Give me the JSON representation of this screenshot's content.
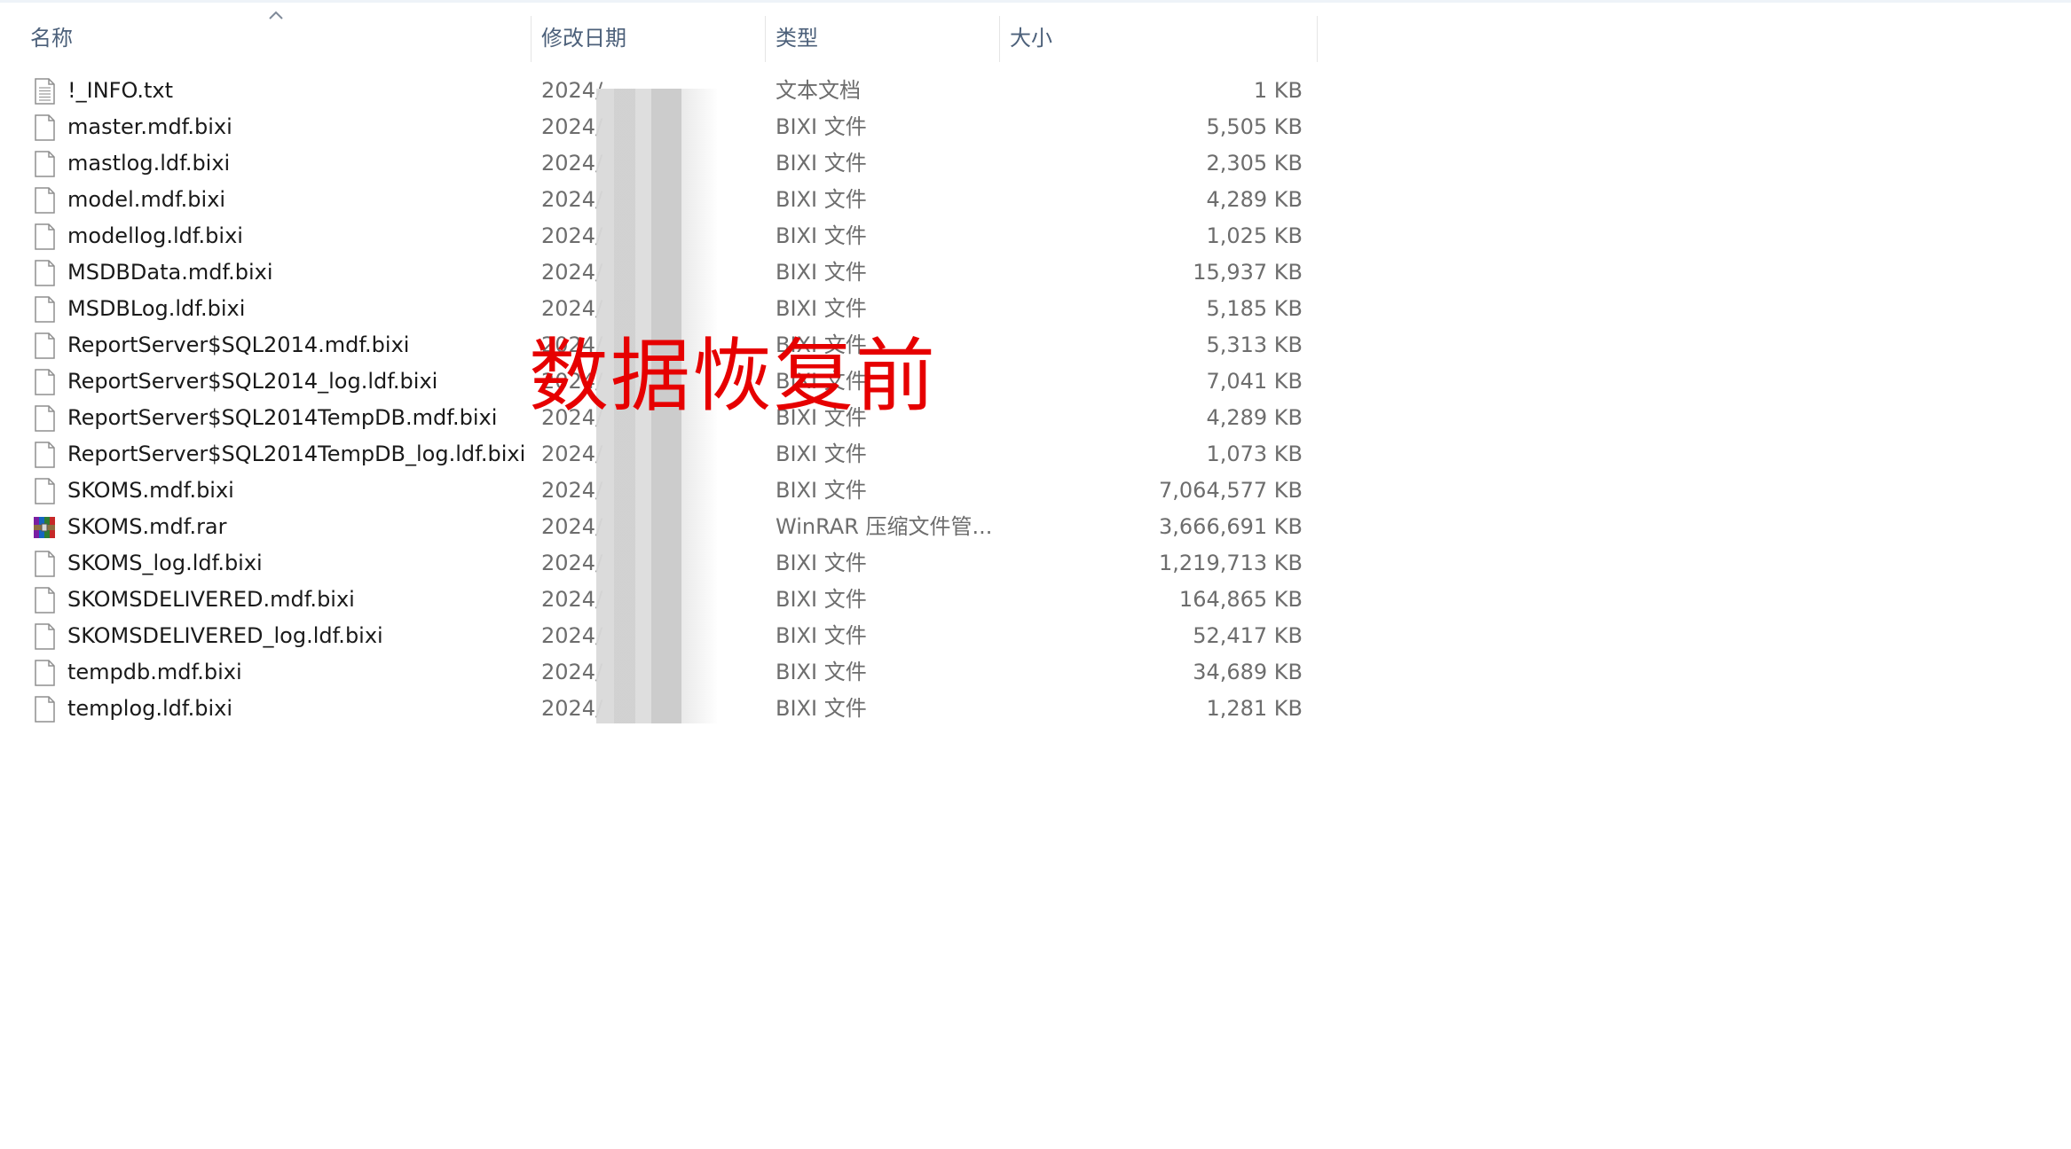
{
  "columns": {
    "name": "名称",
    "date": "修改日期",
    "type": "类型",
    "size": "大小"
  },
  "files": [
    {
      "name": "!_INFO.txt",
      "date": "2024/",
      "type": "文本文档",
      "size": "1 KB",
      "icon": "text-file-icon"
    },
    {
      "name": "master.mdf.bixi",
      "date": "2024/",
      "type": "BIXI 文件",
      "size": "5,505 KB",
      "icon": "blank-file-icon"
    },
    {
      "name": "mastlog.ldf.bixi",
      "date": "2024/",
      "type": "BIXI 文件",
      "size": "2,305 KB",
      "icon": "blank-file-icon"
    },
    {
      "name": "model.mdf.bixi",
      "date": "2024/",
      "type": "BIXI 文件",
      "size": "4,289 KB",
      "icon": "blank-file-icon"
    },
    {
      "name": "modellog.ldf.bixi",
      "date": "2024/",
      "type": "BIXI 文件",
      "size": "1,025 KB",
      "icon": "blank-file-icon"
    },
    {
      "name": "MSDBData.mdf.bixi",
      "date": "2024/",
      "type": "BIXI 文件",
      "size": "15,937 KB",
      "icon": "blank-file-icon"
    },
    {
      "name": "MSDBLog.ldf.bixi",
      "date": "2024/",
      "type": "BIXI 文件",
      "size": "5,185 KB",
      "icon": "blank-file-icon"
    },
    {
      "name": "ReportServer$SQL2014.mdf.bixi",
      "date": "2024/",
      "type": "BIXI 文件",
      "size": "5,313 KB",
      "icon": "blank-file-icon"
    },
    {
      "name": "ReportServer$SQL2014_log.ldf.bixi",
      "date": "2024/",
      "type": "BIXI 文件",
      "size": "7,041 KB",
      "icon": "blank-file-icon"
    },
    {
      "name": "ReportServer$SQL2014TempDB.mdf.bixi",
      "date": "2024/",
      "type": "BIXI 文件",
      "size": "4,289 KB",
      "icon": "blank-file-icon"
    },
    {
      "name": "ReportServer$SQL2014TempDB_log.ldf.bixi",
      "date": "2024/",
      "type": "BIXI 文件",
      "size": "1,073 KB",
      "icon": "blank-file-icon"
    },
    {
      "name": "SKOMS.mdf.bixi",
      "date": "2024/",
      "type": "BIXI 文件",
      "size": "7,064,577 KB",
      "icon": "blank-file-icon"
    },
    {
      "name": "SKOMS.mdf.rar",
      "date": "2024/",
      "type": "WinRAR 压缩文件管...",
      "size": "3,666,691 KB",
      "icon": "winrar-archive-icon"
    },
    {
      "name": "SKOMS_log.ldf.bixi",
      "date": "2024/",
      "type": "BIXI 文件",
      "size": "1,219,713 KB",
      "icon": "blank-file-icon"
    },
    {
      "name": "SKOMSDELIVERED.mdf.bixi",
      "date": "2024/",
      "type": "BIXI 文件",
      "size": "164,865 KB",
      "icon": "blank-file-icon"
    },
    {
      "name": "SKOMSDELIVERED_log.ldf.bixi",
      "date": "2024/",
      "type": "BIXI 文件",
      "size": "52,417 KB",
      "icon": "blank-file-icon"
    },
    {
      "name": "tempdb.mdf.bixi",
      "date": "2024/",
      "type": "BIXI 文件",
      "size": "34,689 KB",
      "icon": "blank-file-icon"
    },
    {
      "name": "templog.ldf.bixi",
      "date": "2024/",
      "type": "BIXI 文件",
      "size": "1,281 KB",
      "icon": "blank-file-icon"
    }
  ],
  "overlay": {
    "text": "数据恢复前",
    "color": "#e60000"
  },
  "colors": {
    "header_text": "#4c607a",
    "name_text": "#1a1a1a",
    "meta_text": "#6d6d6d"
  }
}
